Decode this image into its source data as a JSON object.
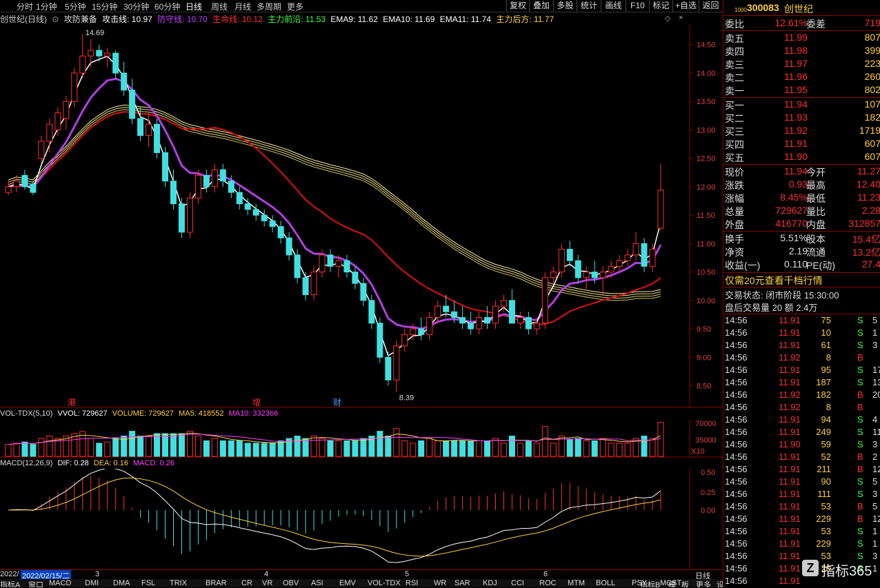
{
  "periods": [
    "分时",
    "1分钟",
    "5分钟",
    "15分钟",
    "30分钟",
    "60分钟",
    "日线",
    "周线",
    "月线",
    "多周期",
    "更多"
  ],
  "active_period": "日线",
  "toolbar": [
    "复权",
    "叠加",
    "多股",
    "统计",
    "画线",
    "F10",
    "标记",
    "+自选",
    "返回"
  ],
  "stock_title": "创世纪(日线)",
  "indicator": {
    "name": "攻防兼备",
    "attack": "攻击线: 10.97",
    "defense": "防守线: 10.70",
    "life": "生命线: 10.12",
    "main_front": "主力前沿: 11.53",
    "ema9": "EMA9: 11.62",
    "ema10": "EMA10: 11.69",
    "ema11": "EMA11: 11.74",
    "main_back": "主力后方: 11.77"
  },
  "price_axis": [
    "14.50",
    "14.00",
    "13.50",
    "13.00",
    "12.50",
    "12.00",
    "11.50",
    "11.00",
    "10.50",
    "10.00",
    "9.50",
    "9.00",
    "8.50"
  ],
  "annotations": {
    "high": "14.69",
    "low": "8.39",
    "mark1": "港",
    "mark2": "增",
    "mark3": "财"
  },
  "vol": {
    "name": "VOL-TDX(5,10)",
    "vvol": "VVOL: 729627",
    "volume": "VOLUME: 729627",
    "ma5": "MA5: 418552",
    "ma10": "MA10: 332366",
    "axis": [
      "70000",
      "35000"
    ],
    "unit": "X10"
  },
  "macd": {
    "name": "MACD(12,26,9)",
    "dif": "DIF: 0.28",
    "dea": "DEA: 0.16",
    "macd": "MACD: 0.26",
    "axis": [
      "0.50",
      "0.25",
      "0.00"
    ]
  },
  "date_axis": {
    "start": "2022/",
    "cursor": "2022/02/15/二",
    "m3": "3",
    "m4": "4",
    "m5": "5",
    "m6": "6",
    "label": "日线"
  },
  "bottom_tabs": [
    "指标A",
    "窗口",
    "MACD",
    "DMI",
    "DMA",
    "FSL",
    "TRIX",
    "BRAR",
    "CR",
    "VR",
    "OBV",
    "ASI",
    "EMV",
    "VOL-TDX",
    "RSI",
    "WR",
    "SAR",
    "KDJ",
    "CCI",
    "ROC",
    "MTM",
    "BOLL",
    "PSY",
    "MCST",
    "更多",
    "设置",
    "指标B",
    "模",
    "板"
  ],
  "quote": {
    "code": "300083",
    "name": "创世纪",
    "badge": "1000",
    "weibi_label": "委比",
    "weibi": "12.61%",
    "weicha_label": "委差",
    "weicha": "719",
    "asks": [
      {
        "l": "卖五",
        "p": "11.99",
        "v": "807"
      },
      {
        "l": "卖四",
        "p": "11.98",
        "v": "399"
      },
      {
        "l": "卖三",
        "p": "11.97",
        "v": "223"
      },
      {
        "l": "卖二",
        "p": "11.96",
        "v": "260"
      },
      {
        "l": "卖一",
        "p": "11.95",
        "v": "802"
      }
    ],
    "bids": [
      {
        "l": "买一",
        "p": "11.94",
        "v": "107"
      },
      {
        "l": "买二",
        "p": "11.93",
        "v": "182"
      },
      {
        "l": "买三",
        "p": "11.92",
        "v": "1719"
      },
      {
        "l": "买四",
        "p": "11.91",
        "v": "607"
      },
      {
        "l": "买五",
        "p": "11.90",
        "v": "607"
      }
    ],
    "stats": [
      {
        "l": "现价",
        "v": "11.94",
        "l2": "今开",
        "v2": "11.27"
      },
      {
        "l": "涨跌",
        "v": "0.93",
        "l2": "最高",
        "v2": "12.40"
      },
      {
        "l": "涨幅",
        "v": "8.45%",
        "l2": "最低",
        "v2": "11.23"
      },
      {
        "l": "总量",
        "v": "729627",
        "l2": "量比",
        "v2": "2.28"
      },
      {
        "l": "外盘",
        "v": "416770",
        "l2": "内盘",
        "v2": "312857"
      }
    ],
    "stats2": [
      {
        "l": "换手",
        "v": "5.51%",
        "l2": "股本",
        "v2": "15.4亿"
      },
      {
        "l": "净资",
        "v": "2.19",
        "l2": "流通",
        "v2": "13.2亿"
      },
      {
        "l": "收益(一)",
        "v": "0.110",
        "l2": "PE(动)",
        "v2": "27.4"
      }
    ],
    "promo": "仅需20元查看千档行情",
    "trade_status": "交易状态: 闭市阶段 15:30:00",
    "after_hours": "盘后交易量 20 额 2.4万"
  },
  "ticks": [
    {
      "t": "14:56",
      "p": "11.91",
      "v": "75",
      "s": "S",
      "x": "5"
    },
    {
      "t": "14:56",
      "p": "11.91",
      "v": "10",
      "s": "S",
      "x": "1"
    },
    {
      "t": "14:56",
      "p": "11.91",
      "v": "61",
      "s": "S",
      "x": "3"
    },
    {
      "t": "14:56",
      "p": "11.92",
      "v": "8",
      "s": "B",
      "x": ""
    },
    {
      "t": "14:56",
      "p": "11.91",
      "v": "95",
      "s": "S",
      "x": "17"
    },
    {
      "t": "14:56",
      "p": "11.91",
      "v": "187",
      "s": "S",
      "x": "13"
    },
    {
      "t": "14:56",
      "p": "11.92",
      "v": "182",
      "s": "B",
      "x": "20"
    },
    {
      "t": "14:56",
      "p": "11.92",
      "v": "8",
      "s": "B",
      "x": ""
    },
    {
      "t": "14:56",
      "p": "11.91",
      "v": "94",
      "s": "S",
      "x": "4"
    },
    {
      "t": "14:56",
      "p": "11.91",
      "v": "249",
      "s": "S",
      "x": "11"
    },
    {
      "t": "14:56",
      "p": "11.90",
      "v": "59",
      "s": "S",
      "x": "3"
    },
    {
      "t": "14:56",
      "p": "11.91",
      "v": "52",
      "s": "B",
      "x": "2"
    },
    {
      "t": "14:56",
      "p": "11.91",
      "v": "211",
      "s": "B",
      "x": "12"
    },
    {
      "t": "14:56",
      "p": "11.91",
      "v": "90",
      "s": "S",
      "x": "5"
    },
    {
      "t": "14:56",
      "p": "11.91",
      "v": "111",
      "s": "S",
      "x": "3"
    },
    {
      "t": "14:56",
      "p": "11.91",
      "v": "53",
      "s": "B",
      "x": "5"
    },
    {
      "t": "14:56",
      "p": "11.91",
      "v": "229",
      "s": "B",
      "x": "12"
    },
    {
      "t": "14:56",
      "p": "11.91",
      "v": "53",
      "s": "S",
      "x": "1"
    },
    {
      "t": "14:56",
      "p": "11.91",
      "v": "229",
      "s": "S",
      "x": "1"
    },
    {
      "t": "14:56",
      "p": "11.91",
      "v": "53",
      "s": "S",
      "x": "3"
    },
    {
      "t": "14:56",
      "p": "11.91",
      "v": "20",
      "s": "S",
      "x": "1"
    },
    {
      "t": "14:56",
      "p": "11.91",
      "v": "",
      "s": "",
      "x": ""
    }
  ],
  "watermark": "指标365",
  "chart_data": {
    "type": "candlestick",
    "ylim": [
      8.3,
      14.8
    ],
    "candles": [
      [
        11.9,
        12.1,
        11.85,
        12.0
      ],
      [
        12.0,
        12.2,
        11.9,
        12.1
      ],
      [
        12.2,
        12.3,
        11.95,
        12.0
      ],
      [
        12.05,
        12.1,
        11.85,
        11.9
      ],
      [
        12.5,
        12.9,
        12.4,
        12.8
      ],
      [
        12.8,
        13.2,
        12.6,
        13.1
      ],
      [
        13.0,
        13.4,
        12.9,
        13.3
      ],
      [
        13.2,
        13.6,
        13.0,
        13.5
      ],
      [
        13.5,
        14.1,
        13.4,
        14.0
      ],
      [
        14.0,
        14.69,
        13.9,
        14.3
      ],
      [
        14.3,
        14.6,
        14.1,
        14.4
      ],
      [
        14.4,
        14.5,
        14.2,
        14.3
      ],
      [
        14.3,
        14.45,
        14.1,
        14.35
      ],
      [
        14.35,
        14.4,
        13.9,
        14.0
      ],
      [
        14.0,
        14.2,
        13.6,
        13.7
      ],
      [
        13.7,
        13.9,
        13.1,
        13.2
      ],
      [
        13.2,
        13.4,
        12.8,
        12.9
      ],
      [
        12.9,
        13.3,
        12.7,
        13.1
      ],
      [
        13.1,
        13.2,
        12.5,
        12.6
      ],
      [
        12.6,
        12.7,
        12.0,
        12.1
      ],
      [
        12.1,
        12.3,
        11.6,
        11.7
      ],
      [
        11.7,
        11.8,
        11.1,
        11.2
      ],
      [
        11.2,
        11.9,
        11.1,
        11.8
      ],
      [
        11.8,
        12.3,
        11.7,
        12.2
      ],
      [
        12.2,
        12.3,
        11.9,
        12.0
      ],
      [
        12.0,
        12.4,
        11.9,
        12.3
      ],
      [
        12.3,
        12.4,
        12.0,
        12.1
      ],
      [
        12.1,
        12.2,
        11.8,
        11.9
      ],
      [
        11.9,
        12.0,
        11.6,
        11.7
      ],
      [
        11.7,
        11.8,
        11.5,
        11.6
      ],
      [
        11.6,
        11.7,
        11.4,
        11.5
      ],
      [
        11.5,
        11.6,
        11.3,
        11.4
      ],
      [
        11.4,
        11.5,
        11.2,
        11.3
      ],
      [
        11.3,
        11.4,
        11.0,
        11.1
      ],
      [
        11.1,
        11.2,
        10.7,
        10.8
      ],
      [
        10.8,
        10.9,
        10.3,
        10.4
      ],
      [
        10.4,
        10.5,
        10.0,
        10.1
      ],
      [
        10.1,
        10.6,
        10.0,
        10.5
      ],
      [
        10.5,
        10.9,
        10.4,
        10.8
      ],
      [
        10.8,
        10.9,
        10.5,
        10.6
      ],
      [
        10.6,
        10.8,
        10.4,
        10.7
      ],
      [
        10.7,
        10.8,
        10.4,
        10.5
      ],
      [
        10.5,
        10.6,
        10.2,
        10.3
      ],
      [
        10.3,
        10.4,
        9.9,
        10.0
      ],
      [
        10.0,
        10.1,
        9.5,
        9.6
      ],
      [
        9.6,
        9.7,
        8.9,
        9.0
      ],
      [
        9.0,
        9.1,
        8.5,
        8.6
      ],
      [
        8.6,
        9.3,
        8.39,
        9.2
      ],
      [
        9.2,
        9.5,
        9.1,
        9.4
      ],
      [
        9.4,
        9.6,
        9.3,
        9.5
      ],
      [
        9.5,
        9.7,
        9.3,
        9.4
      ],
      [
        9.4,
        9.8,
        9.3,
        9.7
      ],
      [
        9.7,
        10.0,
        9.6,
        9.9
      ],
      [
        9.9,
        10.1,
        9.7,
        9.8
      ],
      [
        9.8,
        10.0,
        9.6,
        9.7
      ],
      [
        9.7,
        9.9,
        9.5,
        9.6
      ],
      [
        9.6,
        9.8,
        9.4,
        9.5
      ],
      [
        9.5,
        9.8,
        9.4,
        9.7
      ],
      [
        9.7,
        9.9,
        9.5,
        9.6
      ],
      [
        9.6,
        10.0,
        9.5,
        9.9
      ],
      [
        9.9,
        10.1,
        9.8,
        10.0
      ],
      [
        10.0,
        10.2,
        9.6,
        9.6
      ],
      [
        9.6,
        9.8,
        9.5,
        9.7
      ],
      [
        9.7,
        9.8,
        9.4,
        9.5
      ],
      [
        9.5,
        9.7,
        9.4,
        9.6
      ],
      [
        9.6,
        10.5,
        9.5,
        10.4
      ],
      [
        10.4,
        10.6,
        10.3,
        10.5
      ],
      [
        10.5,
        11.0,
        10.4,
        10.9
      ],
      [
        10.9,
        11.05,
        10.6,
        10.7
      ],
      [
        10.7,
        10.8,
        10.3,
        10.4
      ],
      [
        10.4,
        10.6,
        10.2,
        10.5
      ],
      [
        10.5,
        10.7,
        10.3,
        10.4
      ],
      [
        10.4,
        10.6,
        10.1,
        10.5
      ],
      [
        10.5,
        10.7,
        10.4,
        10.6
      ],
      [
        10.6,
        10.8,
        10.5,
        10.7
      ],
      [
        10.7,
        10.9,
        10.6,
        10.8
      ],
      [
        10.8,
        11.2,
        10.7,
        11.0
      ],
      [
        11.0,
        11.1,
        10.5,
        10.6
      ],
      [
        10.6,
        11.0,
        10.5,
        10.9
      ],
      [
        11.27,
        12.4,
        11.23,
        11.94
      ]
    ],
    "x_marks": [
      "2022/",
      "3",
      "4",
      "5",
      "6"
    ]
  }
}
